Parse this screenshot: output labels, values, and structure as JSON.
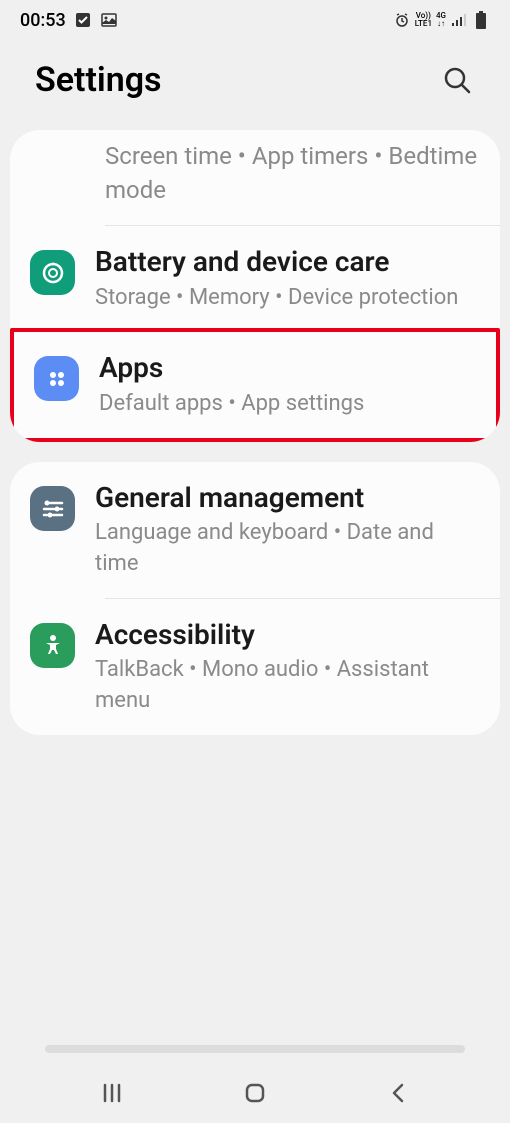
{
  "status": {
    "time": "00:53",
    "net_label_top": "Vo))",
    "net_label_bot": "LTE1",
    "net_gen": "4G"
  },
  "header": {
    "title": "Settings"
  },
  "group1": {
    "item0": {
      "subtitle": "Screen time  •  App timers  •  Bedtime mode"
    },
    "item1": {
      "title": "Battery and device care",
      "subtitle": "Storage  •  Memory  •  Device protection"
    },
    "item2": {
      "title": "Apps",
      "subtitle": "Default apps  •  App settings"
    }
  },
  "group2": {
    "item0": {
      "title": "General management",
      "subtitle": "Language and keyboard  •  Date and time"
    },
    "item1": {
      "title": "Accessibility",
      "subtitle": "TalkBack  •  Mono audio  •  Assistant menu"
    }
  }
}
